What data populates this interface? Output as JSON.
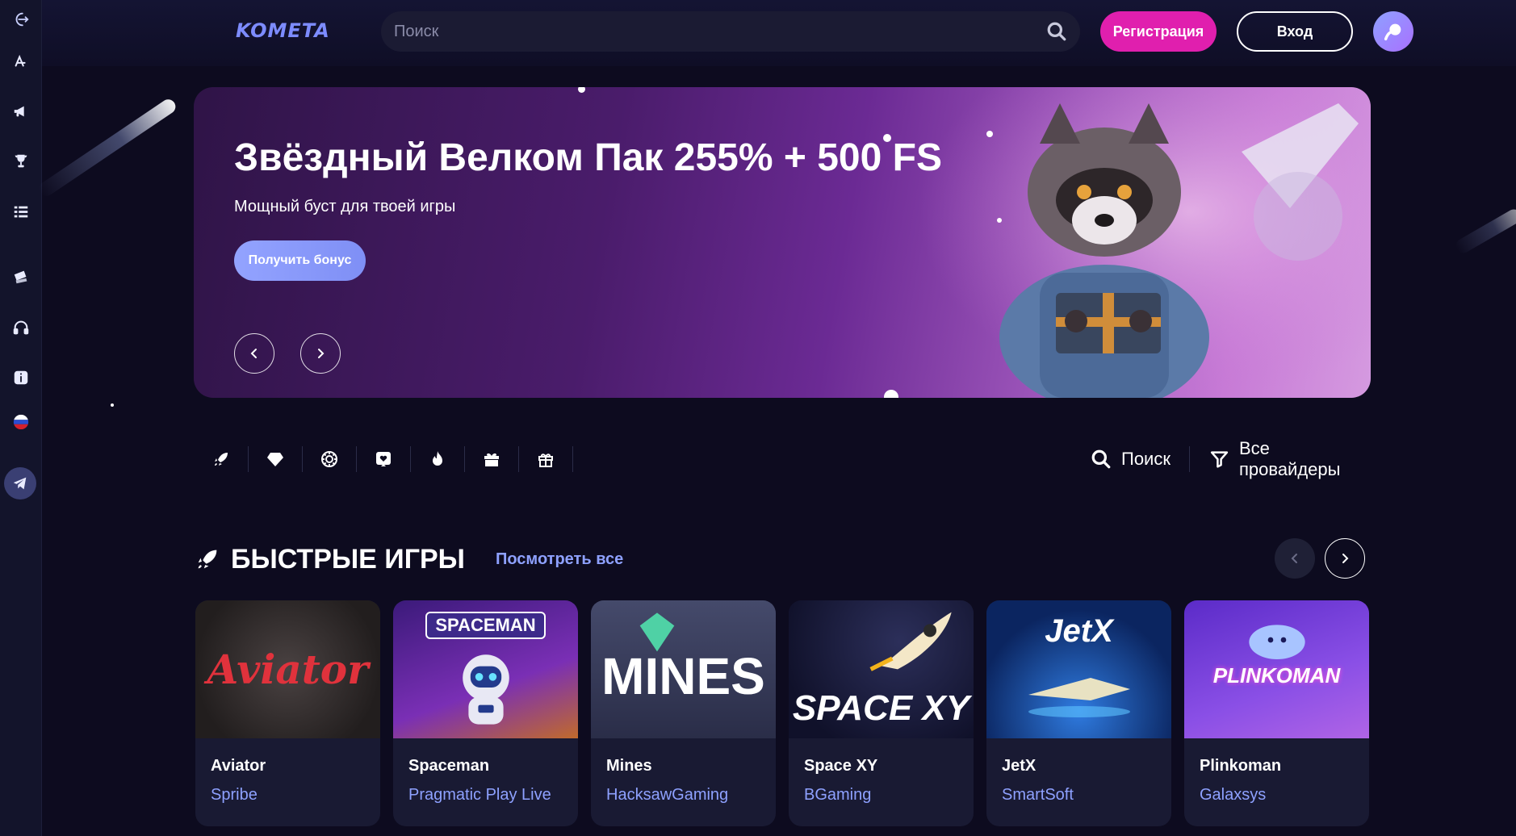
{
  "header": {
    "logo": "KOMETA",
    "search_placeholder": "Поиск",
    "register_label": "Регистрация",
    "login_label": "Вход"
  },
  "sidebar": {
    "items": [
      "login-icon",
      "font-icon",
      "megaphone-icon",
      "trophy-icon",
      "list-icon",
      "ticket-icon",
      "headset-icon",
      "info-icon",
      "russia-flag-icon",
      "telegram-icon"
    ]
  },
  "banner": {
    "title": "Звёздный Велком Пак 255% + 500 FS",
    "subtitle": "Мощный буст для твоей игры",
    "button_label": "Получить бонус"
  },
  "categories": {
    "icons": [
      "rocket-icon",
      "diamond-icon",
      "chip-icon",
      "heart-icon",
      "fire-icon",
      "gift-icon",
      "gift-outline-icon"
    ],
    "search_label": "Поиск",
    "providers_label": "Все провайдеры"
  },
  "section": {
    "title": "БЫСТРЫЕ ИГРЫ",
    "view_all": "Посмотреть все"
  },
  "games": [
    {
      "name": "Aviator",
      "provider": "Spribe",
      "art": "Aviator",
      "bg": "#2a2626",
      "fg": "#e0323c"
    },
    {
      "name": "Spaceman",
      "provider": "Pragmatic Play Live",
      "art": "SPACEMAN",
      "bg": "#5a2a8f",
      "fg": "#ffffff"
    },
    {
      "name": "Mines",
      "provider": "HacksawGaming",
      "art": "MINES",
      "bg": "#3a3d5a",
      "fg": "#ffffff"
    },
    {
      "name": "Space XY",
      "provider": "BGaming",
      "art": "SPACE XY",
      "bg": "#13142d",
      "fg": "#ffffff"
    },
    {
      "name": "JetX",
      "provider": "SmartSoft",
      "art": "JetX",
      "bg": "#0c2a6b",
      "fg": "#ffffff"
    },
    {
      "name": "Plinkoman",
      "provider": "Galaxsys",
      "art": "PLINKOMAN",
      "bg": "#7b3fe0",
      "fg": "#ffffff"
    }
  ],
  "colors": {
    "accent": "#e01fae",
    "link": "#8ea1ff",
    "background": "#0d0b1f",
    "sidebar": "#13142b"
  }
}
